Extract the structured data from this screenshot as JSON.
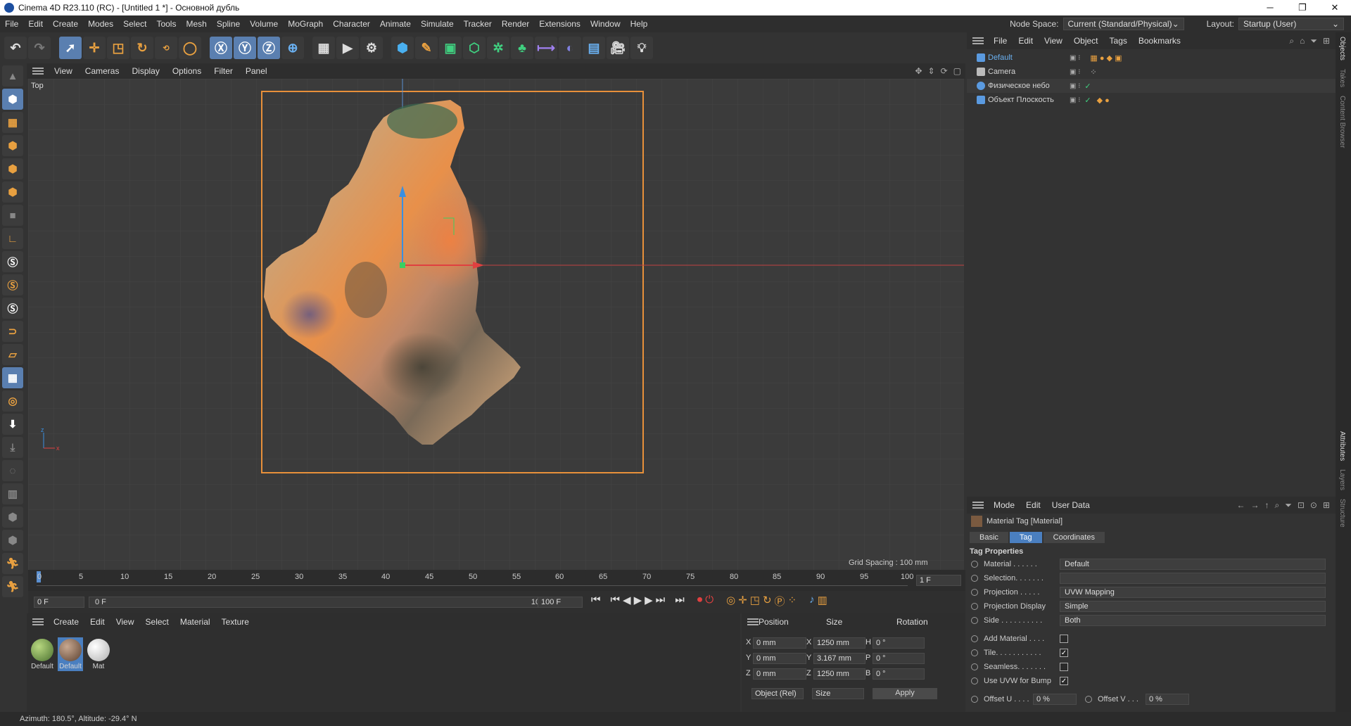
{
  "window": {
    "title": "Cinema 4D R23.110 (RC) - [Untitled 1 *] - Основной дубль",
    "minimize": "─",
    "maximize": "❐",
    "close": "✕"
  },
  "menubar": {
    "items": [
      "File",
      "Edit",
      "Create",
      "Modes",
      "Select",
      "Tools",
      "Mesh",
      "Spline",
      "Volume",
      "MoGraph",
      "Character",
      "Animate",
      "Simulate",
      "Tracker",
      "Render",
      "Extensions",
      "Window",
      "Help"
    ],
    "node_space_label": "Node Space:",
    "node_space_value": "Current (Standard/Physical)",
    "layout_label": "Layout:",
    "layout_value": "Startup (User)"
  },
  "viewport": {
    "menu": [
      "View",
      "Cameras",
      "Display",
      "Options",
      "Filter",
      "Panel"
    ],
    "view_name": "Top",
    "grid_spacing": "Grid Spacing : 100 mm"
  },
  "timeline": {
    "ticks": [
      "0",
      "5",
      "10",
      "15",
      "20",
      "25",
      "30",
      "35",
      "40",
      "45",
      "50",
      "55",
      "60",
      "65",
      "70",
      "75",
      "80",
      "85",
      "90",
      "95",
      "100"
    ],
    "current_frame": "1 F",
    "start_field": "0 F",
    "range_start": "0 F",
    "range_end": "100 F",
    "end_field": "100 F"
  },
  "material_manager": {
    "menu": [
      "Create",
      "Edit",
      "View",
      "Select",
      "Material",
      "Texture"
    ],
    "materials": [
      {
        "name": "Default",
        "color": "#7fa040"
      },
      {
        "name": "Default",
        "color": "#8a6a50"
      },
      {
        "name": "Mat",
        "color": "#e8e8e8"
      }
    ]
  },
  "coordinates": {
    "headers": [
      "Position",
      "Size",
      "Rotation"
    ],
    "rows": [
      {
        "axis": "X",
        "pos": "0 mm",
        "size_axis": "X",
        "size": "1250 mm",
        "rot_axis": "H",
        "rot": "0 °"
      },
      {
        "axis": "Y",
        "pos": "0 mm",
        "size_axis": "Y",
        "size": "3.167 mm",
        "rot_axis": "P",
        "rot": "0 °"
      },
      {
        "axis": "Z",
        "pos": "0 mm",
        "size_axis": "Z",
        "size": "1250 mm",
        "rot_axis": "B",
        "rot": "0 °"
      }
    ],
    "mode": "Object (Rel)",
    "size_mode": "Size",
    "apply": "Apply"
  },
  "object_manager": {
    "menu": [
      "File",
      "Edit",
      "View",
      "Object",
      "Tags",
      "Bookmarks"
    ],
    "objects": [
      {
        "name": "Default",
        "color": "#5a9ae0"
      },
      {
        "name": "Camera",
        "color": "#bbbbbb"
      },
      {
        "name": "Физическое небо",
        "color": "#5a9ae0"
      },
      {
        "name": "Объект Плоскость",
        "color": "#5a9ae0"
      }
    ]
  },
  "attributes": {
    "menu": [
      "Mode",
      "Edit",
      "User Data"
    ],
    "header": "Material Tag [Material]",
    "tabs": [
      "Basic",
      "Tag",
      "Coordinates"
    ],
    "section": "Tag Properties",
    "props": [
      {
        "label": "Material . . . . . .",
        "value": "Default"
      },
      {
        "label": "Selection. . . . . . .",
        "value": ""
      },
      {
        "label": "Projection . . . . .",
        "value": "UVW Mapping"
      },
      {
        "label": "Projection Display",
        "value": "Simple"
      },
      {
        "label": "Side . . . . . . . . . .",
        "value": "Both"
      }
    ],
    "checks": [
      {
        "label": "Add Material . . . .",
        "checked": ""
      },
      {
        "label": "Tile. . . . . . . . . . .",
        "checked": "✓"
      },
      {
        "label": "Seamless. . . . . . .",
        "checked": ""
      },
      {
        "label": "Use UVW for Bump",
        "checked": "✓"
      }
    ],
    "offset_u_label": "Offset U . . . .",
    "offset_u": "0 %",
    "offset_v_label": "Offset V . . .",
    "offset_v": "0 %"
  },
  "right_strip": [
    "Objects",
    "Takes",
    "Content Browser",
    "Attributes",
    "Layers",
    "Structure"
  ],
  "status": "Azimuth: 180.5°, Altitude: -29.4°  N"
}
